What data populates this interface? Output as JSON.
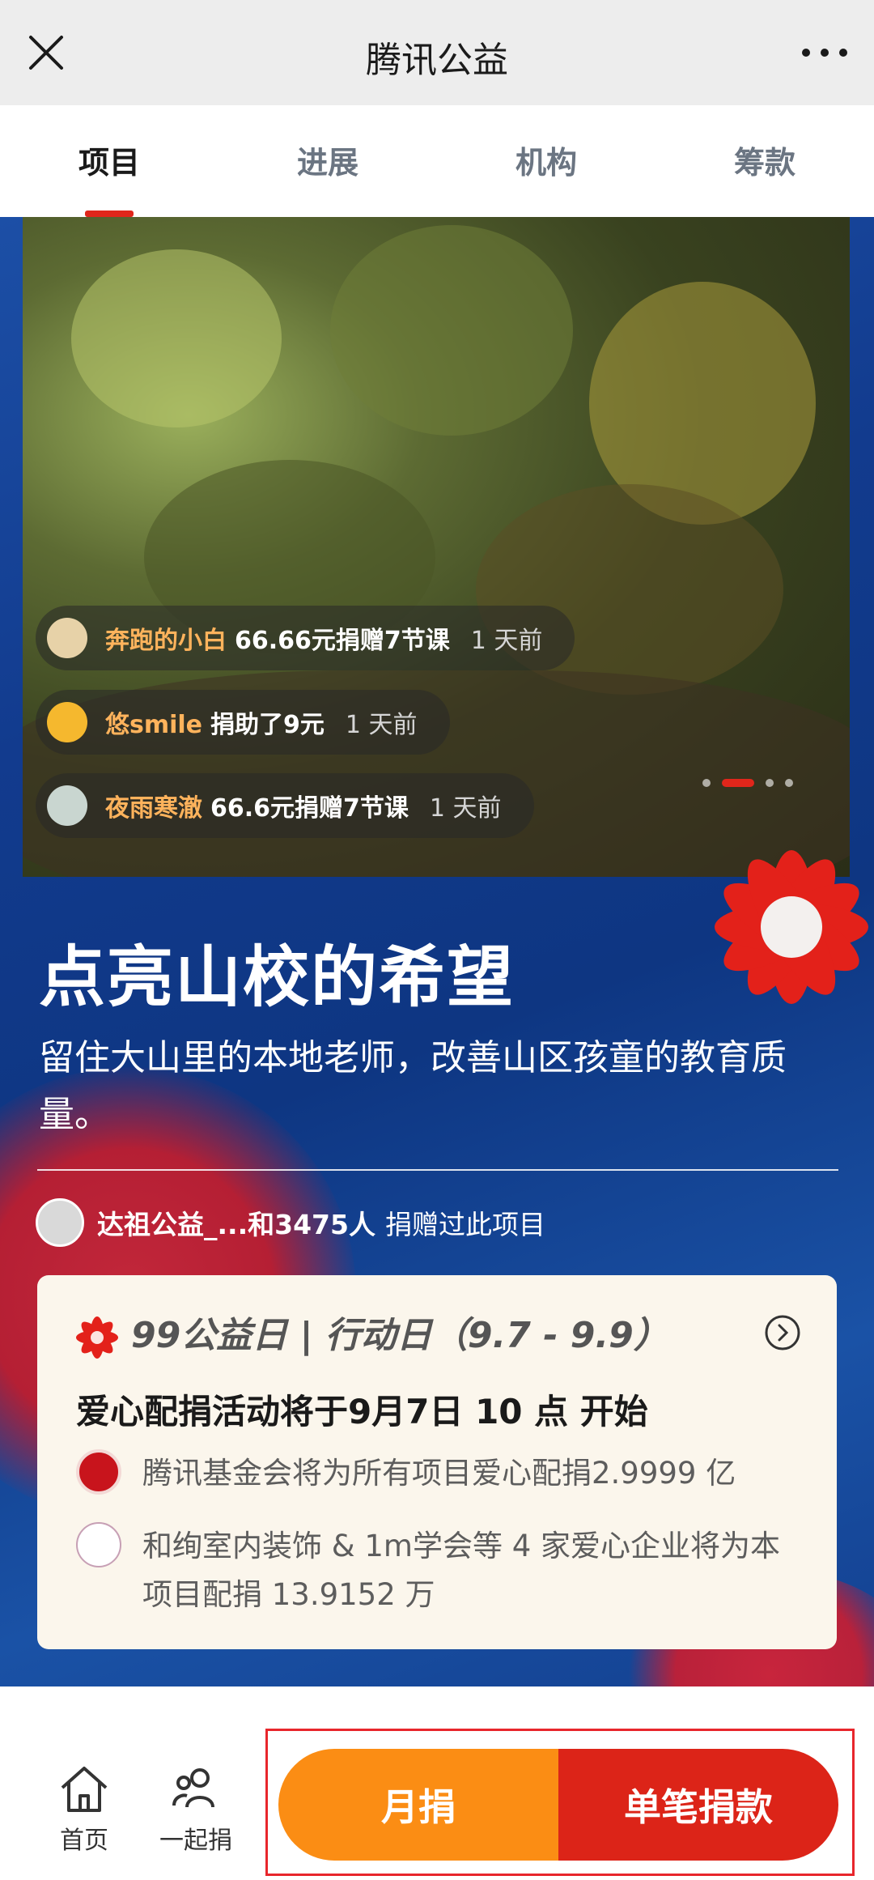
{
  "window": {
    "title": "腾讯公益"
  },
  "tabs": [
    {
      "label": "项目",
      "active": true
    },
    {
      "label": "进展",
      "active": false
    },
    {
      "label": "机构",
      "active": false
    },
    {
      "label": "筹款",
      "active": false
    }
  ],
  "feed": [
    {
      "name": "奔跑的小白",
      "action": "66.66元捐赠7节课",
      "time": "1 天前"
    },
    {
      "name": "悠smile",
      "action": "捐助了9元",
      "time": "1 天前"
    },
    {
      "name": "夜雨寒澈",
      "action": "66.6元捐赠7节课",
      "time": "1 天前"
    }
  ],
  "project": {
    "title": "点亮山校的希望",
    "subtitle": "留住大山里的本地老师，改善山区孩童的教育质量。",
    "donors_bold": "达祖公益_...和3475人",
    "donors_text": "捐赠过此项目"
  },
  "event_card": {
    "title": "99公益日 | 行动日（9.7 - 9.9）",
    "headline": "爱心配捐活动将于9月7日 10 点 开始",
    "rows": [
      {
        "text": "腾讯基金会将为所有项目爱心配捐2.9999 亿"
      },
      {
        "text": "和绚室内装饰 & 1m学会等 4 家爱心企业将为本项目配捐 13.9152 万"
      }
    ]
  },
  "bottom_nav": {
    "home_label": "首页",
    "together_label": "一起捐",
    "monthly_label": "月捐",
    "single_label": "单笔捐款"
  },
  "colors": {
    "accent_red": "#e0261b",
    "orange": "#fb8d14",
    "deep_blue": "#123b8e"
  }
}
